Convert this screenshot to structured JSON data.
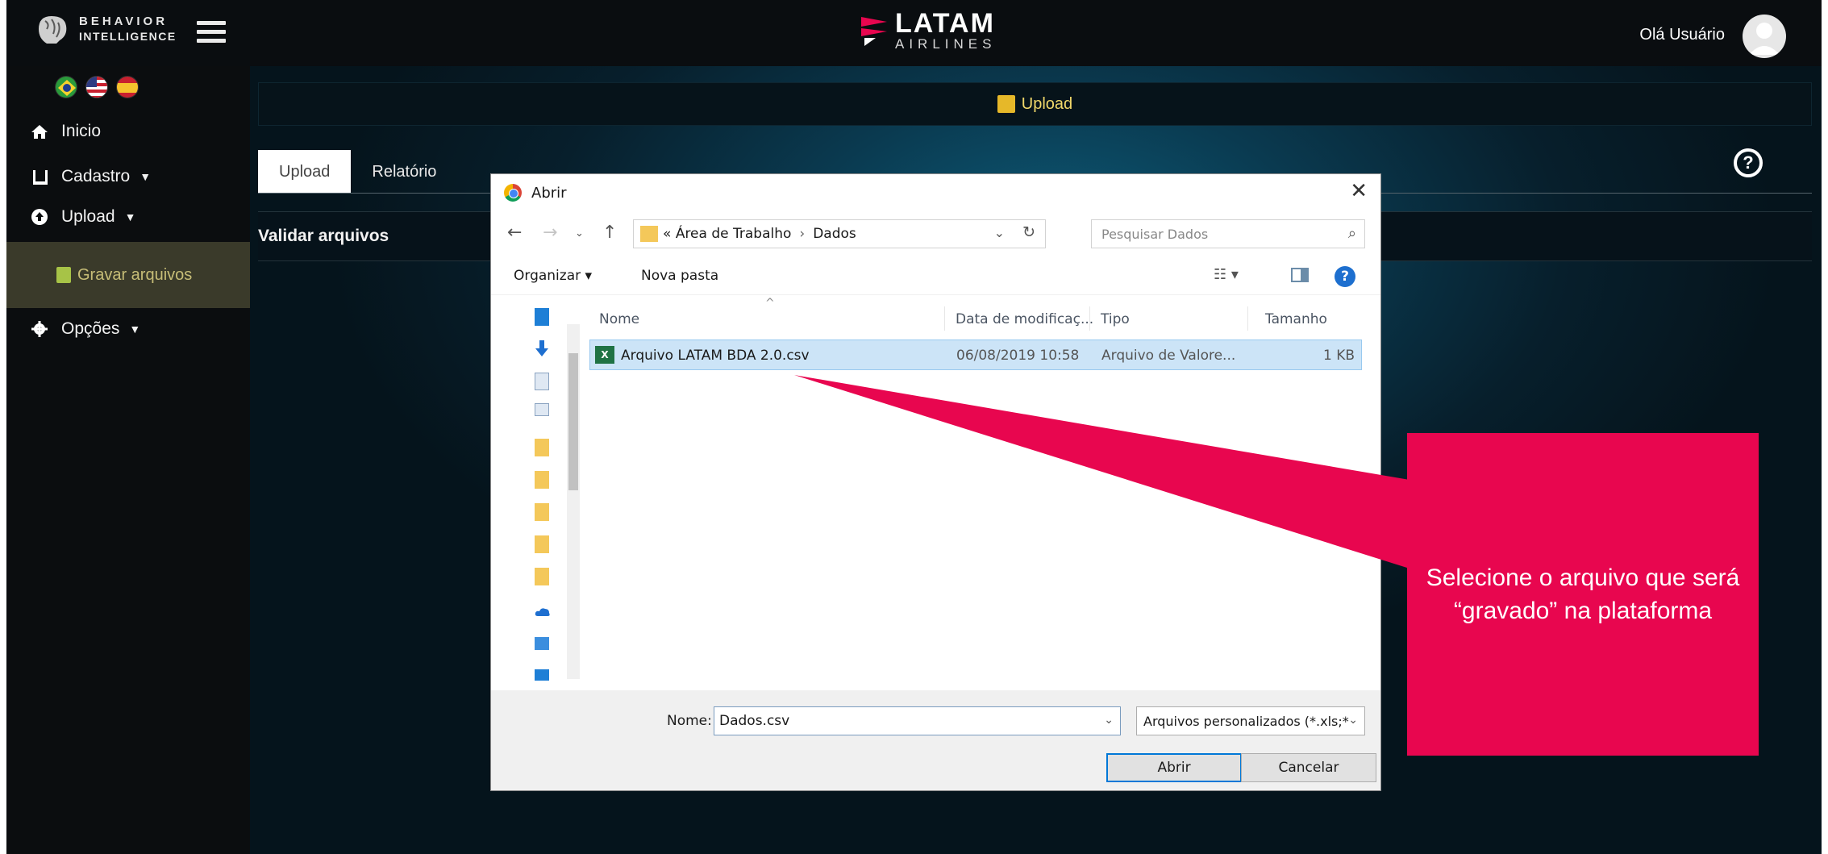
{
  "header": {
    "brand_line1": "BEHAVIOR",
    "brand_line2": "INTELLIGENCE",
    "airline_brand": "LATAM",
    "airline_sub": "AIRLINES",
    "greeting": "Olá Usuário"
  },
  "sidebar": {
    "items": [
      {
        "label": "Inicio",
        "icon": "home-icon"
      },
      {
        "label": "Cadastro",
        "icon": "book-icon"
      },
      {
        "label": "Upload",
        "icon": "upload-icon"
      },
      {
        "label": "Opções",
        "icon": "gear-icon"
      }
    ],
    "sub_item": "Gravar arquivos",
    "flags": [
      "brazil-flag",
      "usa-flag",
      "spain-flag"
    ]
  },
  "main": {
    "banner_title": "Upload",
    "tabs": [
      {
        "label": "Upload",
        "active": true
      },
      {
        "label": "Relatório",
        "active": false
      }
    ],
    "panel_title": "Validar arquivos"
  },
  "dialog": {
    "title": "Abrir",
    "breadcrumb": {
      "root": "«",
      "part1": "Área de Trabalho",
      "sep": "›",
      "part2": "Dados"
    },
    "search_placeholder": "Pesquisar Dados",
    "toolbar": {
      "organize": "Organizar",
      "new_folder": "Nova pasta"
    },
    "columns": {
      "name": "Nome",
      "date": "Data de modificaç...",
      "type": "Tipo",
      "size": "Tamanho"
    },
    "files": [
      {
        "name": "Arquivo LATAM BDA 2.0.csv",
        "date": "06/08/2019 10:58",
        "type": "Arquivo de Valore...",
        "size": "1 KB"
      }
    ],
    "filename_label": "Nome:",
    "filename_value": "Dados.csv",
    "filetype": "Arquivos personalizados (*.xls;*",
    "btn_open": "Abrir",
    "btn_cancel": "Cancelar"
  },
  "callout": {
    "text": "Selecione o arquivo que será “gravado” na plataforma"
  },
  "colors": {
    "accent": "#e8064f",
    "sidebar_bg": "#0b0d0f",
    "banner_text": "#f1d86a",
    "selection": "#cce4f7"
  }
}
